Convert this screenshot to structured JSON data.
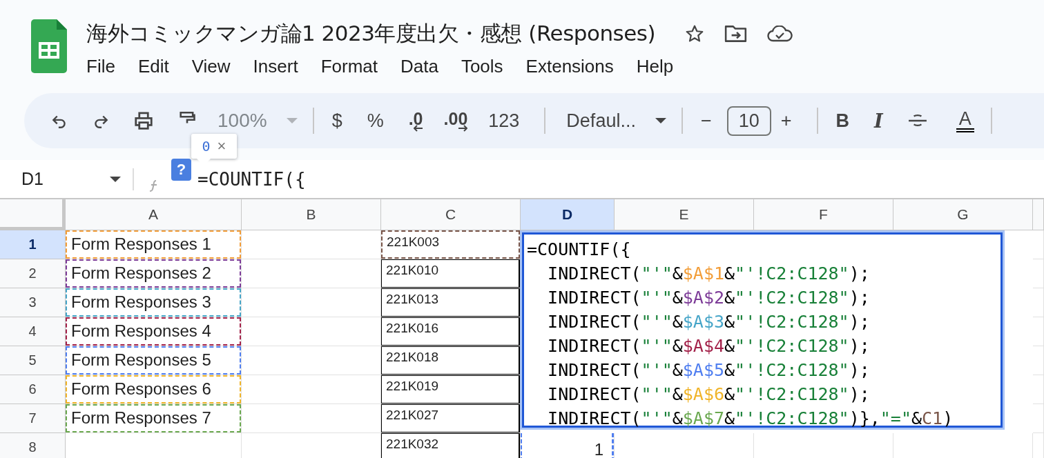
{
  "document": {
    "title": "海外コミックマンガ論1 2023年度出欠・感想 (Responses)"
  },
  "menu": [
    "File",
    "Edit",
    "View",
    "Insert",
    "Format",
    "Data",
    "Tools",
    "Extensions",
    "Help"
  ],
  "toolbar": {
    "zoom": "100%",
    "currency": "$",
    "percent": "%",
    "decrease_decimals": ".0",
    "increase_decimals": ".00",
    "number_format": "123",
    "font": "Defaul...",
    "minus": "−",
    "font_size": "10",
    "plus": "+",
    "bold": "B",
    "italic": "I",
    "text_color": "A"
  },
  "tooltip": {
    "value": "0",
    "close": "×"
  },
  "help_badge": "?",
  "name_box": "D1",
  "formula_bar": "=COUNTIF({",
  "columns": [
    {
      "label": "A",
      "selected": false
    },
    {
      "label": "B",
      "selected": false
    },
    {
      "label": "C",
      "selected": false
    },
    {
      "label": "D",
      "selected": true
    },
    {
      "label": "E",
      "selected": false
    },
    {
      "label": "F",
      "selected": false
    },
    {
      "label": "G",
      "selected": false
    }
  ],
  "rows": [
    {
      "number": "1",
      "selected": true,
      "a": {
        "text": "Form Responses 1",
        "color": "#f29d38"
      },
      "c": {
        "text": "221K003",
        "color": "#795548"
      },
      "d": ""
    },
    {
      "number": "2",
      "selected": false,
      "a": {
        "text": "Form Responses 2",
        "color": "#7d3c98"
      },
      "c": {
        "text": "221K010"
      },
      "d": ""
    },
    {
      "number": "3",
      "selected": false,
      "a": {
        "text": "Form Responses 3",
        "color": "#46a5c8"
      },
      "c": {
        "text": "221K013"
      },
      "d": ""
    },
    {
      "number": "4",
      "selected": false,
      "a": {
        "text": "Form Responses 4",
        "color": "#a3224a"
      },
      "c": {
        "text": "221K016"
      },
      "d": ""
    },
    {
      "number": "5",
      "selected": false,
      "a": {
        "text": "Form Responses 5",
        "color": "#4f7ef0"
      },
      "c": {
        "text": "221K018"
      },
      "d": ""
    },
    {
      "number": "6",
      "selected": false,
      "a": {
        "text": "Form Responses 6",
        "color": "#f0b429"
      },
      "c": {
        "text": "221K019"
      },
      "d": ""
    },
    {
      "number": "7",
      "selected": false,
      "a": {
        "text": "Form Responses 7",
        "color": "#6aa84f"
      },
      "c": {
        "text": "221K027"
      },
      "d": ""
    },
    {
      "number": "8",
      "selected": false,
      "a": null,
      "c": {
        "text": "221K032"
      },
      "d": "1"
    }
  ],
  "editor": {
    "lines": [
      [
        {
          "t": "=COUNTIF({",
          "color": "#000000"
        }
      ],
      [
        {
          "t": "  INDIRECT(",
          "color": "#000000"
        },
        {
          "t": "\"'\"",
          "color": "#188038"
        },
        {
          "t": "&",
          "color": "#000000"
        },
        {
          "t": "$A$1",
          "color": "#f29d38"
        },
        {
          "t": "&",
          "color": "#000000"
        },
        {
          "t": "\"'!C2:C128\"",
          "color": "#188038"
        },
        {
          "t": ");",
          "color": "#000000"
        }
      ],
      [
        {
          "t": "  INDIRECT(",
          "color": "#000000"
        },
        {
          "t": "\"'\"",
          "color": "#188038"
        },
        {
          "t": "&",
          "color": "#000000"
        },
        {
          "t": "$A$2",
          "color": "#7d3c98"
        },
        {
          "t": "&",
          "color": "#000000"
        },
        {
          "t": "\"'!C2:C128\"",
          "color": "#188038"
        },
        {
          "t": ");",
          "color": "#000000"
        }
      ],
      [
        {
          "t": "  INDIRECT(",
          "color": "#000000"
        },
        {
          "t": "\"'\"",
          "color": "#188038"
        },
        {
          "t": "&",
          "color": "#000000"
        },
        {
          "t": "$A$3",
          "color": "#46a5c8"
        },
        {
          "t": "&",
          "color": "#000000"
        },
        {
          "t": "\"'!C2:C128\"",
          "color": "#188038"
        },
        {
          "t": ");",
          "color": "#000000"
        }
      ],
      [
        {
          "t": "  INDIRECT(",
          "color": "#000000"
        },
        {
          "t": "\"'\"",
          "color": "#188038"
        },
        {
          "t": "&",
          "color": "#000000"
        },
        {
          "t": "$A$4",
          "color": "#a3224a"
        },
        {
          "t": "&",
          "color": "#000000"
        },
        {
          "t": "\"'!C2:C128\"",
          "color": "#188038"
        },
        {
          "t": ");",
          "color": "#000000"
        }
      ],
      [
        {
          "t": "  INDIRECT(",
          "color": "#000000"
        },
        {
          "t": "\"'\"",
          "color": "#188038"
        },
        {
          "t": "&",
          "color": "#000000"
        },
        {
          "t": "$A$5",
          "color": "#4f7ef0"
        },
        {
          "t": "&",
          "color": "#000000"
        },
        {
          "t": "\"'!C2:C128\"",
          "color": "#188038"
        },
        {
          "t": ");",
          "color": "#000000"
        }
      ],
      [
        {
          "t": "  INDIRECT(",
          "color": "#000000"
        },
        {
          "t": "\"'\"",
          "color": "#188038"
        },
        {
          "t": "&",
          "color": "#000000"
        },
        {
          "t": "$A$6",
          "color": "#f0b429"
        },
        {
          "t": "&",
          "color": "#000000"
        },
        {
          "t": "\"'!C2:C128\"",
          "color": "#188038"
        },
        {
          "t": ");",
          "color": "#000000"
        }
      ],
      [
        {
          "t": "  INDIRECT(",
          "color": "#000000"
        },
        {
          "t": "\"'\"",
          "color": "#188038"
        },
        {
          "t": "&",
          "color": "#000000"
        },
        {
          "t": "$A$7",
          "color": "#6aa84f"
        },
        {
          "t": "&",
          "color": "#000000"
        },
        {
          "t": "\"'!C2:C128\"",
          "color": "#188038"
        },
        {
          "t": ")},",
          "color": "#000000"
        },
        {
          "t": "\"=\"",
          "color": "#188038"
        },
        {
          "t": "&",
          "color": "#000000"
        },
        {
          "t": "C1",
          "color": "#795548"
        },
        {
          "t": ")",
          "color": "#000000"
        }
      ]
    ]
  }
}
